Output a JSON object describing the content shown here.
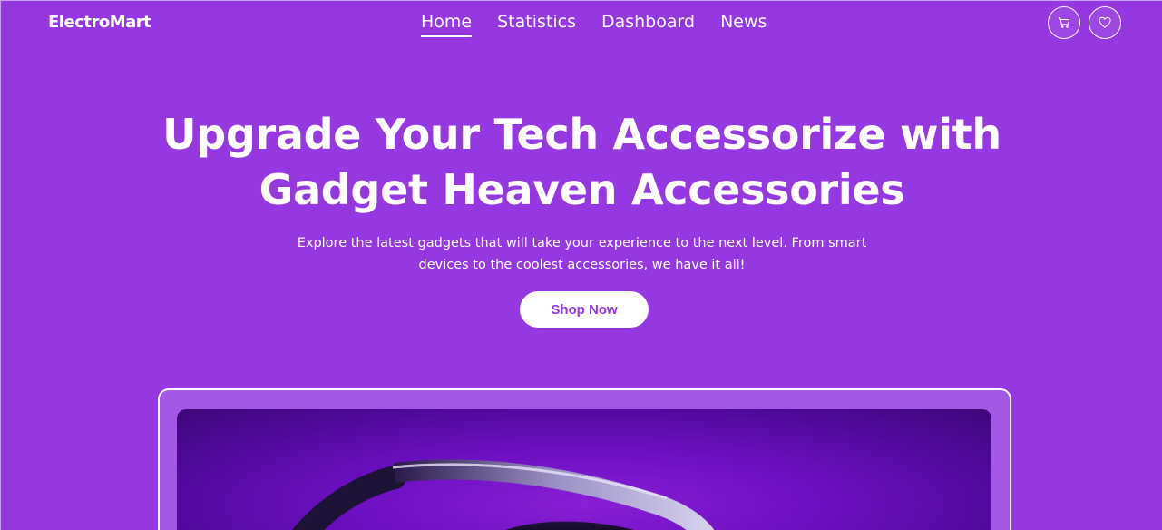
{
  "brand": "ElectroMart",
  "nav": {
    "links": [
      "Home",
      "Statistics",
      "Dashboard",
      "News"
    ],
    "active": "Home"
  },
  "icons": {
    "cart": "cart-icon",
    "wishlist": "heart-icon"
  },
  "hero": {
    "title_line1": "Upgrade Your Tech Accessorize with",
    "title_line2": "Gadget Heaven Accessories",
    "subtitle_line1": "Explore the latest gadgets that will take your experience to the next level. From smart",
    "subtitle_line2": "devices to the coolest accessories, we have it all!",
    "cta": "Shop Now"
  },
  "colors": {
    "background": "#9538e2",
    "button_text": "#9538e2",
    "banner_dark": "#4f0a9a"
  }
}
